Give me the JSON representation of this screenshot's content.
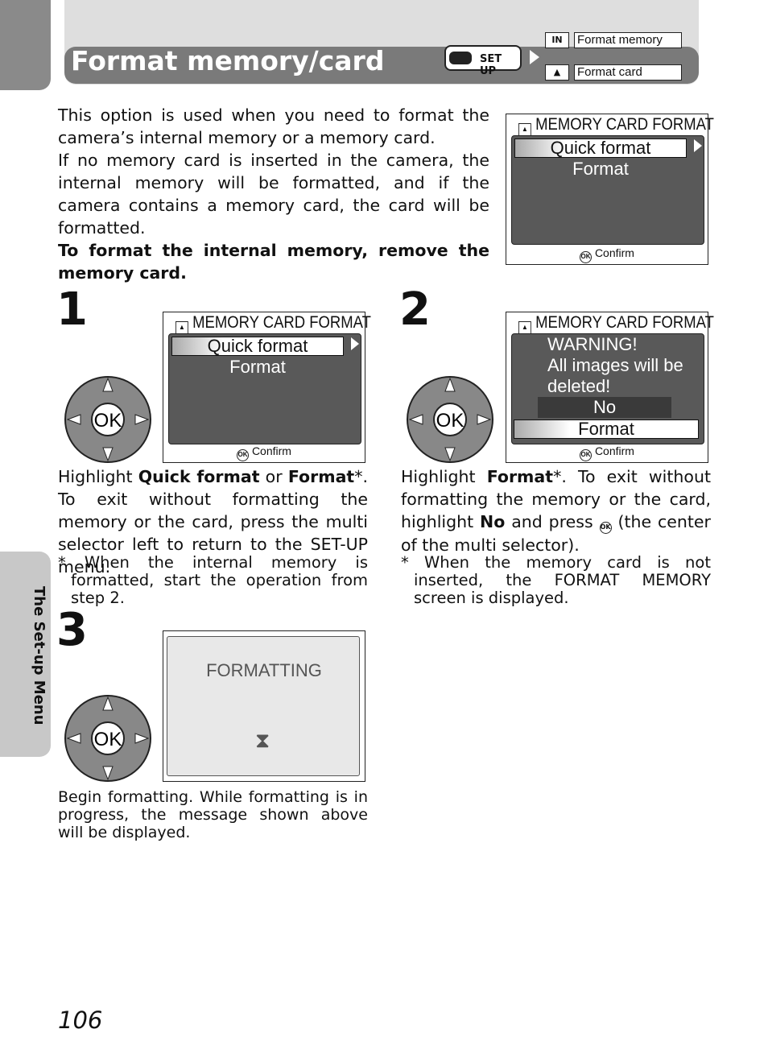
{
  "header": {
    "title": "Format memory/card",
    "setup_label": "SET UP",
    "menu": [
      {
        "icon": "IN",
        "label": "Format memory"
      },
      {
        "icon": "card",
        "label": "Format card"
      }
    ]
  },
  "intro": {
    "p1": "This option is used when you need to format the camera’s internal memory or a memory card.",
    "p2": "If no memory card is inserted in the camera, the internal memory will be formatted, and if the camera contains a memory card, the card will be formatted.",
    "p3": "To format the internal memory, remove the memory card."
  },
  "screen_title": "MEMORY CARD FORMAT",
  "quick_format": "Quick format",
  "format": "Format",
  "confirm": "Confirm",
  "ok": "OK",
  "step1": {
    "num": "1",
    "t1": "Highlight ",
    "b1": "Quick format",
    "t2": " or ",
    "b2": "Format",
    "t3": "*. To exit without formatting the memory or the card, press the multi selector left to return to the SET-UP menu.",
    "note": "* When the internal memory is formatted, start the operation from step 2."
  },
  "step2": {
    "num": "2",
    "warning": "WARNING!",
    "warn2": "All images will be",
    "warn3": "deleted!",
    "no": "No",
    "t1": "Highlight ",
    "b1": "Format",
    "t2": "*. To exit without formatting the memory or the card, highlight ",
    "b2": "No",
    "t3": " and press ",
    "t4": " (the center of the multi selector).",
    "note": "* When the memory card is not inserted, the FORMAT MEMORY screen is displayed."
  },
  "step3": {
    "num": "3",
    "formatting": "FORMATTING",
    "text": "Begin formatting. While formatting is in progress, the message shown above will be displayed."
  },
  "side_tab": "The Set-up Menu",
  "page_number": "106"
}
